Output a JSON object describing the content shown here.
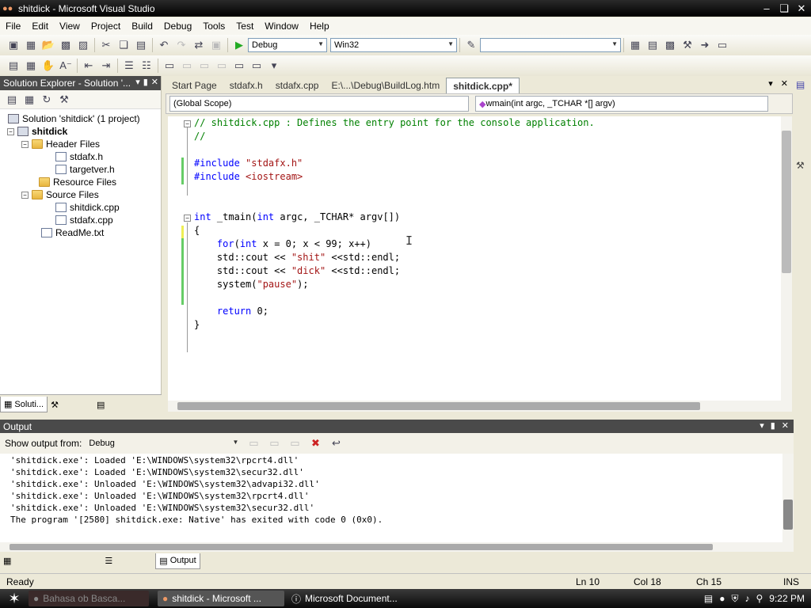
{
  "window": {
    "title": "shitdick - Microsoft Visual Studio"
  },
  "menu": [
    "File",
    "Edit",
    "View",
    "Project",
    "Build",
    "Debug",
    "Tools",
    "Test",
    "Window",
    "Help"
  ],
  "toolbar": {
    "config": "Debug",
    "platform": "Win32"
  },
  "solution_explorer": {
    "title": "Solution Explorer - Solution '...",
    "items": [
      {
        "label": "Solution 'shitdick' (1 project)",
        "bold": false
      },
      {
        "label": "shitdick",
        "bold": true
      },
      {
        "label": "Header Files"
      },
      {
        "label": "stdafx.h"
      },
      {
        "label": "targetver.h"
      },
      {
        "label": "Resource Files"
      },
      {
        "label": "Source Files"
      },
      {
        "label": "shitdick.cpp"
      },
      {
        "label": "stdafx.cpp"
      },
      {
        "label": "ReadMe.txt"
      }
    ],
    "tabs": [
      "Soluti..."
    ]
  },
  "editor": {
    "tabs": [
      "Start Page",
      "stdafx.h",
      "stdafx.cpp",
      "E:\\...\\Debug\\BuildLog.htm",
      "shitdick.cpp*"
    ],
    "scope_left": "(Global Scope)",
    "scope_right": "wmain(int argc, _TCHAR *[] argv)",
    "code": {
      "l1": "// shitdick.cpp : Defines the entry point for the console application.",
      "l2": "//",
      "inc1_kw": "#include",
      "inc1_str": "\"stdafx.h\"",
      "inc2_kw": "#include",
      "inc2_str": "<iostream>",
      "main_int": "int",
      "main_rest_a": " _tmain(",
      "main_int2": "int",
      "main_rest_b": " argc, _TCHAR* argv[])",
      "brace_open": "{",
      "for_kw": "for",
      "for_a": "(",
      "for_int": "int",
      "for_b": " x = 0; x < 99; x++)",
      "cout1_a": "std::cout << ",
      "cout1_str": "\"shit\"",
      "cout1_b": " <<std::endl;",
      "cout2_a": "std::cout << ",
      "cout2_str": "\"dick\"",
      "cout2_b": " <<std::endl;",
      "sys_a": "system(",
      "sys_str": "\"pause\"",
      "sys_b": ");",
      "ret_kw": "return",
      "ret_b": " 0;",
      "brace_close": "}"
    }
  },
  "output": {
    "title": "Output",
    "show_from_label": "Show output from:",
    "show_from_value": "Debug",
    "lines": [
      "'shitdick.exe': Loaded 'E:\\WINDOWS\\system32\\rpcrt4.dll'",
      "'shitdick.exe': Loaded 'E:\\WINDOWS\\system32\\secur32.dll'",
      "'shitdick.exe': Unloaded 'E:\\WINDOWS\\system32\\advapi32.dll'",
      "'shitdick.exe': Unloaded 'E:\\WINDOWS\\system32\\rpcrt4.dll'",
      "'shitdick.exe': Unloaded 'E:\\WINDOWS\\system32\\secur32.dll'",
      "The program '[2580] shitdick.exe: Native' has exited with code 0 (0x0)."
    ],
    "tabs": [
      "Output"
    ]
  },
  "status": {
    "ready": "Ready",
    "ln": "Ln 10",
    "col": "Col 18",
    "ch": "Ch 15",
    "ins": "INS"
  },
  "taskbar": {
    "tasks": [
      "Bahasa ob Basca...",
      "shitdick - Microsoft ...",
      "Microsoft Document..."
    ],
    "clock": "9:22 PM"
  }
}
